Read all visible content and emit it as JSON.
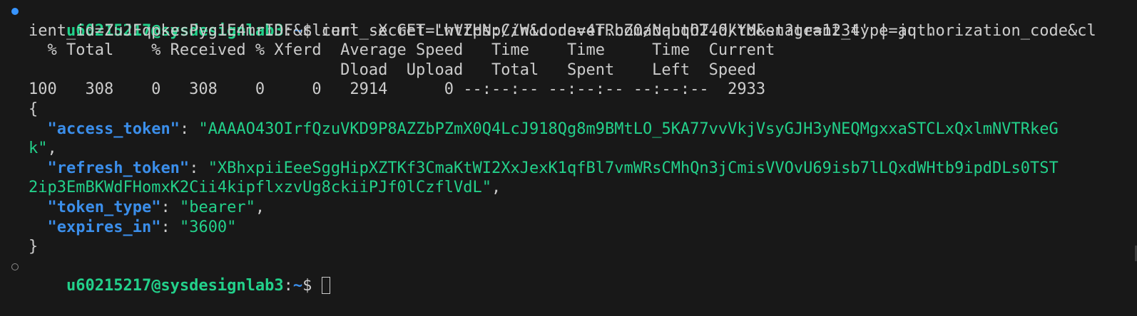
{
  "prompt": {
    "user_host": "u60215217@sysdesignlab3",
    "colon": ":",
    "path": "~",
    "dollar": "$ "
  },
  "command": {
    "line1": "curl -X GET 'https://nid.naver.com/oauth2.0/token?grant_type=authorization_code&cl",
    "line2": "ient_id=ZuJFqpkesPyg1E4mrIDF&client_secret=LwVZHNpCiW&code=4TRbZ0aNqbqOT4dkYM&state=1234' | jq ."
  },
  "progress": {
    "header1": "  % Total    % Received % Xferd  Average Speed   Time    Time     Time  Current",
    "header2": "                                 Dload  Upload   Total   Spent    Left  Speed",
    "row": "100   308    0   308    0     0   2914      0 --:--:-- --:--:-- --:--:--  2933"
  },
  "json_output": {
    "open_brace": "{",
    "close_brace": "}",
    "access_token_key": "\"access_token\"",
    "access_token_val_1": "\"AAAAO43OIrfQzuVKD9P8AZZbPZmX0Q4LcJ918Qg8m9BMtLO_5KA77vvVkjVsyGJH3yNEQMgxxaSTCLxQxlmNVTRkeG",
    "access_token_val_2": "k\"",
    "refresh_token_key": "\"refresh_token\"",
    "refresh_token_val_1": "\"XBhxpiiEeeSggHipXZTKf3CmaKtWI2XxJexK1qfBl7vmWRsCMhQn3jCmisVVOvU69isb7lLQxdWHtb9ipdDLs0TST",
    "refresh_token_val_2": "2ip3EmBKWdFHomxK2Cii4kipflxzvUg8ckiiPJf0lCzflVdL\"",
    "token_type_key": "\"token_type\"",
    "token_type_val": "\"bearer\"",
    "expires_in_key": "\"expires_in\"",
    "expires_in_val": "\"3600\"",
    "kv_sep": ": ",
    "comma": ","
  },
  "colors": {
    "background": "#181818",
    "foreground": "#cccccc",
    "green": "#23d18b",
    "blue": "#3b8eea",
    "success_marker": "#3794ff"
  }
}
